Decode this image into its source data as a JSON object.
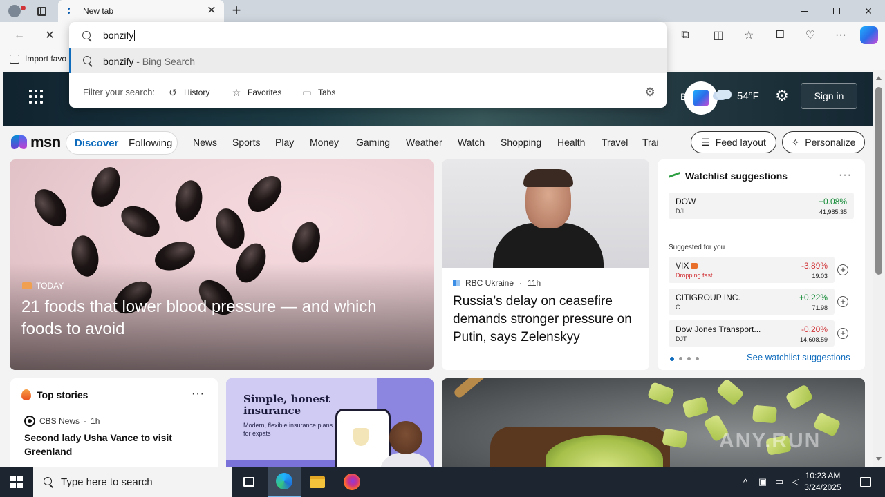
{
  "browser": {
    "tab_title": "New tab",
    "new_tab_symbol": "+",
    "close_symbol": "✕"
  },
  "address": {
    "typed_value": "bonzify",
    "suggestion_query": "bonzify",
    "suggestion_provider": " - Bing Search",
    "filter_label": "Filter your search:",
    "filters": [
      "History",
      "Favorites",
      "Tabs"
    ]
  },
  "favorites_bar": {
    "import_label": "Import favo"
  },
  "hero": {
    "location": "Berlin",
    "temperature": "54°F",
    "signin_label": "Sign in"
  },
  "msn": {
    "logo_text": "msn",
    "tabs": [
      "Discover",
      "Following"
    ],
    "nav": [
      "News",
      "Sports",
      "Play",
      "Money",
      "Gaming",
      "Weather",
      "Watch",
      "Shopping",
      "Health",
      "Travel",
      "Trai"
    ],
    "feed_layout_label": "Feed layout",
    "personalize_label": "Personalize"
  },
  "main_story": {
    "source": "TODAY",
    "title": "21 foods that lower blood pressure — and which foods to avoid"
  },
  "news_story": {
    "source": "RBC Ukraine",
    "age": "11h",
    "title": "Russia’s delay on ceasefire demands stronger pressure on Putin, says Zelenskyy"
  },
  "watchlist": {
    "title": "Watchlist suggestions",
    "more": "···",
    "suggested_label": "Suggested for you",
    "link": "See watchlist suggestions",
    "primary": {
      "symbol": "DOW",
      "sub": "DJI",
      "change": "+0.08%",
      "value": "41,985.35"
    },
    "items": [
      {
        "symbol": "VIX",
        "sub": "Dropping fast",
        "change": "-3.89%",
        "value": "19.03"
      },
      {
        "symbol": "CITIGROUP INC.",
        "sub": "C",
        "change": "+0.22%",
        "value": "71.98"
      },
      {
        "symbol": "Dow Jones Transport...",
        "sub": "DJT",
        "change": "-0.20%",
        "value": "14,608.59"
      }
    ],
    "colors": {
      "up": "#138a36",
      "down": "#d13438"
    }
  },
  "top_stories": {
    "title": "Top stories",
    "more": "···",
    "source": "CBS News",
    "age": "1h",
    "headline": "Second lady Usha Vance to visit Greenland"
  },
  "ad": {
    "title": "Simple, honest insurance",
    "subtitle": "Modern, flexible insurance plans for expats"
  },
  "watermark": "ANY.RUN",
  "taskbar": {
    "search_placeholder": "Type here to search",
    "time": "10:23 AM",
    "date": "3/24/2025"
  }
}
